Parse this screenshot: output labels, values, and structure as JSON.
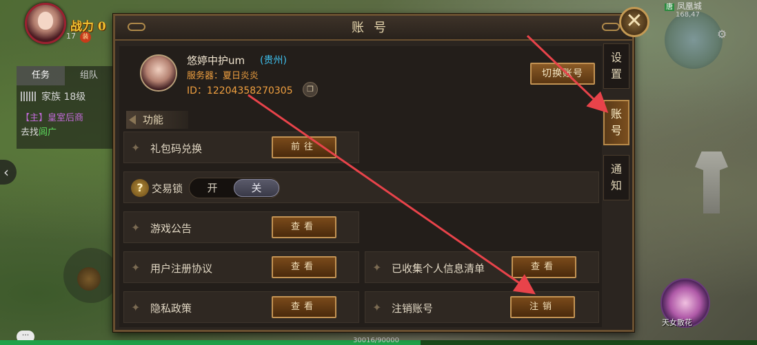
{
  "hud": {
    "combat_power": "战力 0",
    "level": "17",
    "level_badge": "装",
    "quest_tabs": [
      "任务",
      "组队"
    ],
    "family_label": "家族 18级",
    "quest_tag": "【主】皇室后商",
    "quest_prefix": "去找",
    "quest_target": "闾广",
    "left_arrow": "‹",
    "chat_icon": "···",
    "hp_text": "30016/90000",
    "map_tag": "唐",
    "map_name": "凤凰城",
    "coords": "168,47",
    "skill_label": "天女散花"
  },
  "dialog": {
    "title": "账号",
    "close_label": "✕",
    "profile": {
      "name": "悠婷中护um",
      "region": "(贵州)",
      "server": "服务器：夏日炎炎",
      "id": "ID：12204358270305",
      "copy_icon_glyph": "❐",
      "switch_label": "切换账号"
    },
    "section_title": "功能",
    "rows": {
      "gift_code": {
        "label": "礼包码兑换",
        "button": "前往"
      },
      "trade_lock": {
        "label": "交易锁",
        "on": "开",
        "off": "关",
        "state": "off"
      },
      "announcement": {
        "label": "游戏公告",
        "button": "查看"
      },
      "user_agreement": {
        "label": "用户注册协议",
        "button": "查看"
      },
      "personal_info": {
        "label": "已收集个人信息清单",
        "button": "查看"
      },
      "privacy": {
        "label": "隐私政策",
        "button": "查看"
      },
      "cancel_account": {
        "label": "注销账号",
        "button": "注销"
      }
    },
    "side_tabs": [
      {
        "label_top": "设",
        "label_bottom": "置"
      },
      {
        "label_top": "账",
        "label_bottom": "号"
      },
      {
        "label_top": "通",
        "label_bottom": "知"
      }
    ],
    "active_tab": 1
  },
  "colors": {
    "annotation_arrow": "#e8434a",
    "accent_orange": "#f0a040",
    "region_blue": "#3fc2f0"
  },
  "icons": {
    "row_marker": "star-icon",
    "help": "question-icon",
    "close": "close-icon",
    "copy": "copy-icon",
    "settings": "gear-icon"
  }
}
